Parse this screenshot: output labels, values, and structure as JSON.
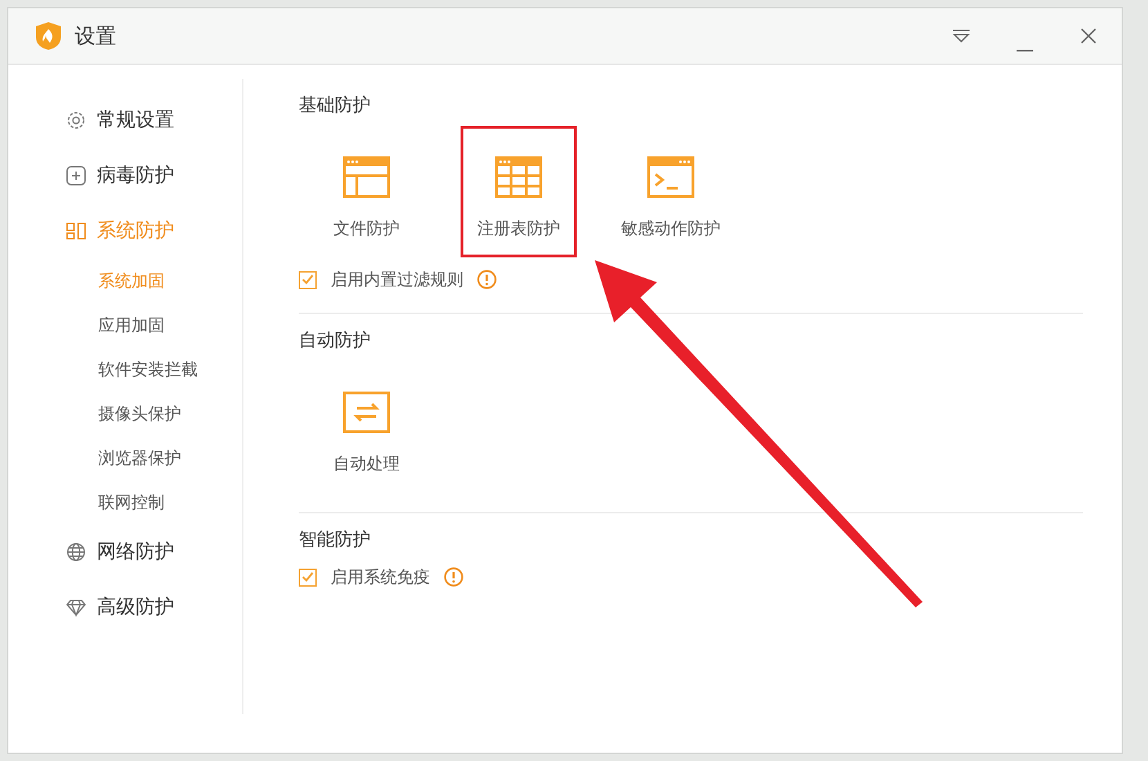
{
  "window": {
    "title": "设置"
  },
  "sidebar": {
    "items": [
      {
        "label": "常规设置",
        "selected": false
      },
      {
        "label": "病毒防护",
        "selected": false
      },
      {
        "label": "系统防护",
        "selected": true,
        "children": [
          {
            "label": "系统加固",
            "selected": true
          },
          {
            "label": "应用加固",
            "selected": false
          },
          {
            "label": "软件安装拦截",
            "selected": false
          },
          {
            "label": "摄像头保护",
            "selected": false
          },
          {
            "label": "浏览器保护",
            "selected": false
          },
          {
            "label": "联网控制",
            "selected": false
          }
        ]
      },
      {
        "label": "网络防护",
        "selected": false
      },
      {
        "label": "高级防护",
        "selected": false
      }
    ]
  },
  "sections": [
    {
      "title": "基础防护",
      "tiles": [
        {
          "label": "文件防护",
          "highlighted": false
        },
        {
          "label": "注册表防护",
          "highlighted": true
        },
        {
          "label": "敏感动作防护",
          "highlighted": false
        }
      ],
      "checkbox": {
        "label": "启用内置过滤规则",
        "checked": true
      }
    },
    {
      "title": "自动防护",
      "tiles": [
        {
          "label": "自动处理",
          "highlighted": false
        }
      ]
    },
    {
      "title": "智能防护",
      "checkbox": {
        "label": "启用系统免疫",
        "checked": true
      }
    }
  ],
  "annotations": [
    {
      "kind": "arrow"
    }
  ]
}
